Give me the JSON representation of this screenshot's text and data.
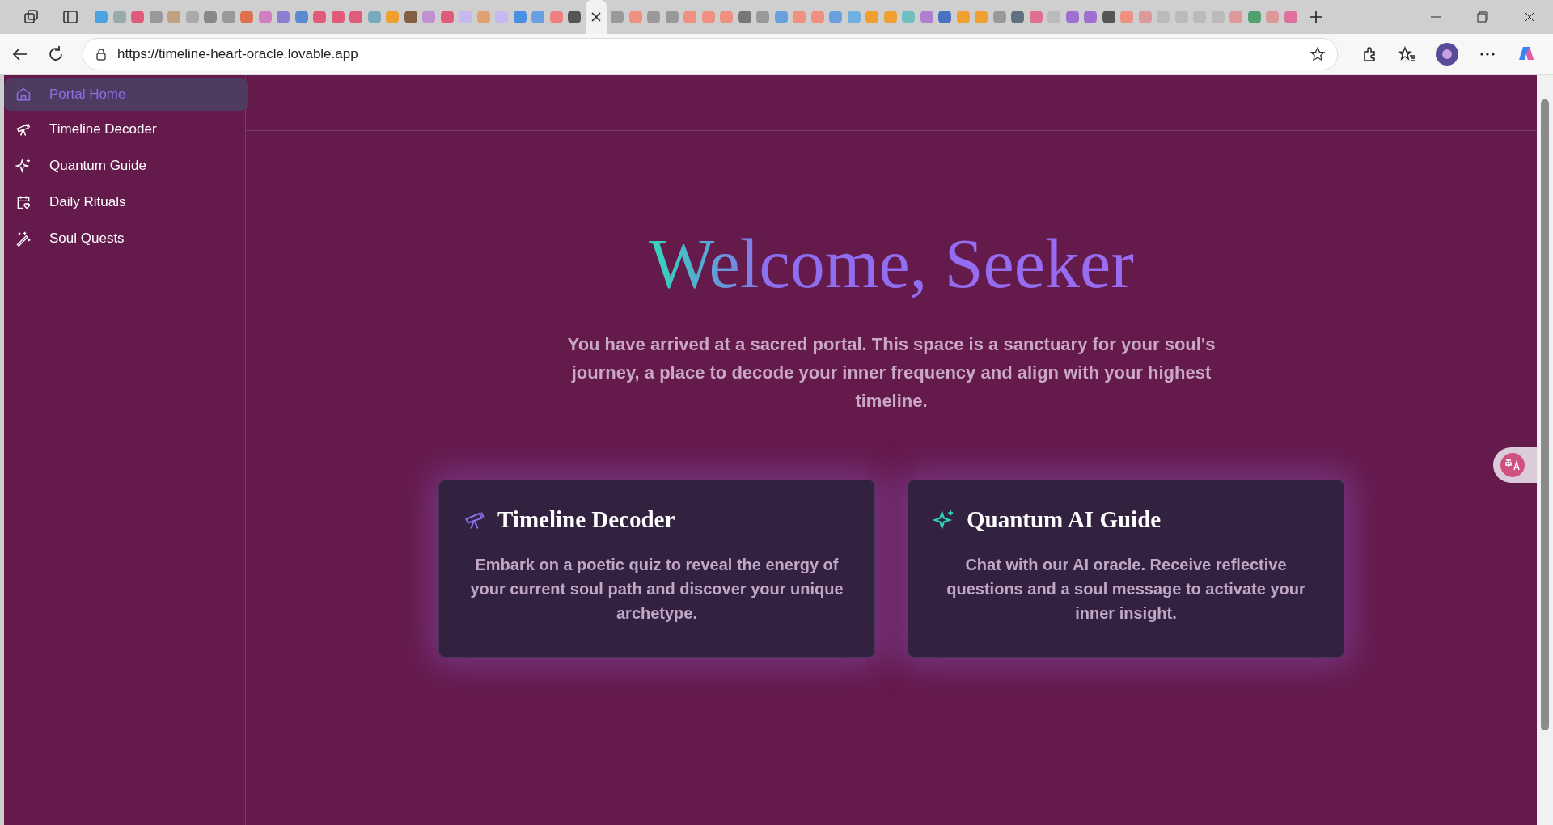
{
  "browser": {
    "url": "https://timeline-heart-oracle.lovable.app"
  },
  "sidebar": {
    "items": [
      {
        "label": "Portal Home",
        "selected": true
      },
      {
        "label": "Timeline Decoder",
        "selected": false
      },
      {
        "label": "Quantum Guide",
        "selected": false
      },
      {
        "label": "Daily Rituals",
        "selected": false
      },
      {
        "label": "Soul Quests",
        "selected": false
      }
    ]
  },
  "hero": {
    "title": "Welcome, Seeker",
    "intro": "You have arrived at a sacred portal. This space is a sanctuary for your soul's journey, a place to decode your inner frequency and align with your highest timeline."
  },
  "cards": [
    {
      "title": "Timeline Decoder",
      "description": "Embark on a poetic quiz to reveal the energy of your current soul path and discover your unique archetype."
    },
    {
      "title": "Quantum AI Guide",
      "description": "Chat with our AI oracle. Receive reflective questions and a soul message to activate your inner insight."
    }
  ]
}
